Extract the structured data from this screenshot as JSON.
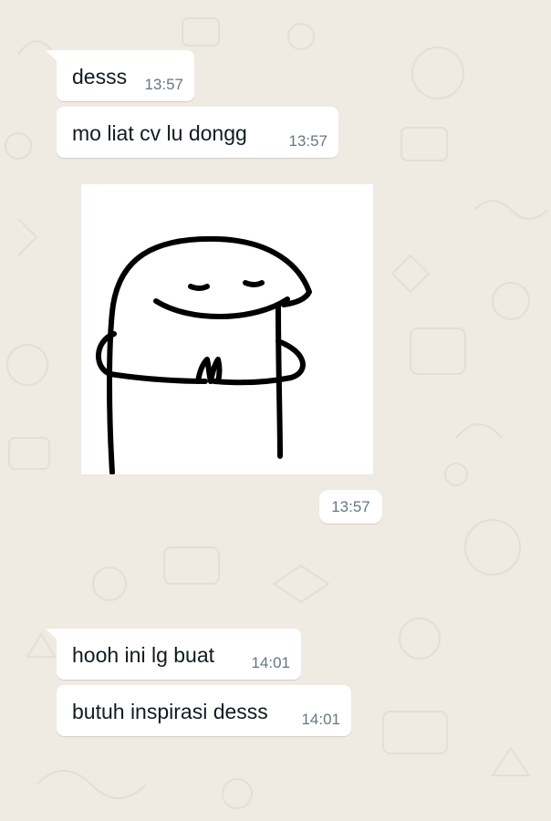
{
  "messages": [
    {
      "text": "desss",
      "time": "13:57"
    },
    {
      "text": "mo liat cv lu dongg",
      "time": "13:57"
    },
    {
      "text": "hooh ini lg buat",
      "time": "14:01"
    },
    {
      "text": "butuh inspirasi desss",
      "time": "14:01"
    }
  ],
  "sticker": {
    "description_icon": "praying-blob-sticker-icon",
    "time": "13:57"
  },
  "colors": {
    "chat_background": "#efeae2",
    "bubble": "#ffffff",
    "text": "#111b21",
    "timestamp": "#667781"
  }
}
